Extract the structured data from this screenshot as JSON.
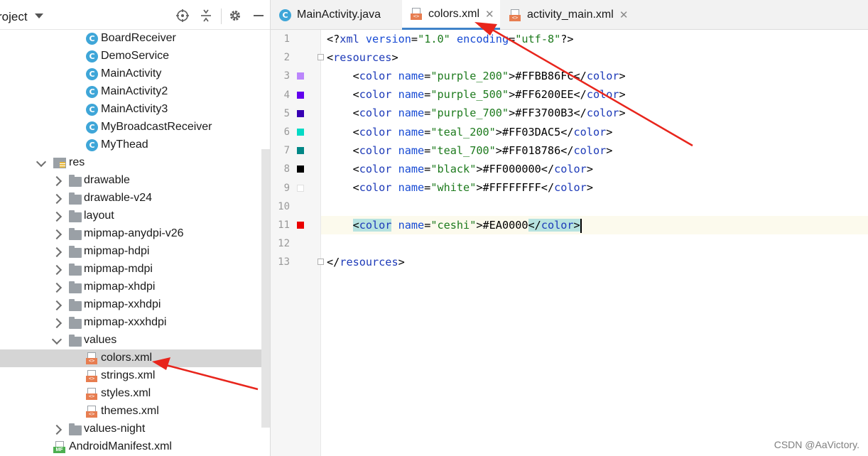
{
  "panel": {
    "title": "roject",
    "icons": [
      "target-icon",
      "collapse-all-icon",
      "gear-icon",
      "minimize-icon"
    ]
  },
  "tree": [
    {
      "label": "BoardReceiver",
      "kind": "class"
    },
    {
      "label": "DemoService",
      "kind": "class"
    },
    {
      "label": "MainActivity",
      "kind": "class"
    },
    {
      "label": "MainActivity2",
      "kind": "class"
    },
    {
      "label": "MainActivity3",
      "kind": "class"
    },
    {
      "label": "MyBroadcastReceiver",
      "kind": "class"
    },
    {
      "label": "MyThead",
      "kind": "class"
    },
    {
      "label": "res",
      "kind": "res",
      "expanded": true
    },
    {
      "label": "drawable",
      "kind": "folder"
    },
    {
      "label": "drawable-v24",
      "kind": "folder"
    },
    {
      "label": "layout",
      "kind": "folder"
    },
    {
      "label": "mipmap-anydpi-v26",
      "kind": "folder"
    },
    {
      "label": "mipmap-hdpi",
      "kind": "folder"
    },
    {
      "label": "mipmap-mdpi",
      "kind": "folder"
    },
    {
      "label": "mipmap-xhdpi",
      "kind": "folder"
    },
    {
      "label": "mipmap-xxhdpi",
      "kind": "folder"
    },
    {
      "label": "mipmap-xxxhdpi",
      "kind": "folder"
    },
    {
      "label": "values",
      "kind": "folder",
      "expanded": true
    },
    {
      "label": "colors.xml",
      "kind": "xml",
      "selected": true
    },
    {
      "label": "strings.xml",
      "kind": "xml"
    },
    {
      "label": "styles.xml",
      "kind": "xml"
    },
    {
      "label": "themes.xml",
      "kind": "xml"
    },
    {
      "label": "values-night",
      "kind": "folder"
    },
    {
      "label": "AndroidManifest.xml",
      "kind": "manifest"
    }
  ],
  "tabs": [
    {
      "label": "MainActivity.java",
      "icon": "java-class-icon",
      "active": false
    },
    {
      "label": "colors.xml",
      "icon": "xml-file-icon",
      "active": true
    },
    {
      "label": "activity_main.xml",
      "icon": "xml-file-icon",
      "active": false
    }
  ],
  "editor": {
    "lines": [
      {
        "n": "1",
        "swatch": null
      },
      {
        "n": "2",
        "swatch": null
      },
      {
        "n": "3",
        "swatch": "#BB86FC"
      },
      {
        "n": "4",
        "swatch": "#6200EE"
      },
      {
        "n": "5",
        "swatch": "#3700B3"
      },
      {
        "n": "6",
        "swatch": "#03DAC5"
      },
      {
        "n": "7",
        "swatch": "#018786"
      },
      {
        "n": "8",
        "swatch": "#000000"
      },
      {
        "n": "9",
        "swatch": "#FFFFFF"
      },
      {
        "n": "10",
        "swatch": null
      },
      {
        "n": "11",
        "swatch": "#EA0000"
      },
      {
        "n": "12",
        "swatch": null
      },
      {
        "n": "13",
        "swatch": null
      }
    ],
    "declaration": {
      "open": "<?",
      "name": "xml",
      "version_attr": "version",
      "version_val": "\"1.0\"",
      "enc_attr": "encoding",
      "enc_val": "\"utf-8\"",
      "close": "?>"
    },
    "resources_open": "resources",
    "resources_close": "resources",
    "colors": [
      {
        "name": "\"purple_200\"",
        "value": "#FFBB86FC"
      },
      {
        "name": "\"purple_500\"",
        "value": "#FF6200EE"
      },
      {
        "name": "\"purple_700\"",
        "value": "#FF3700B3"
      },
      {
        "name": "\"teal_200\"",
        "value": "#FF03DAC5"
      },
      {
        "name": "\"teal_700\"",
        "value": "#FF018786"
      },
      {
        "name": "\"black\"",
        "value": "#FF000000"
      },
      {
        "name": "\"white\"",
        "value": "#FFFFFFFF"
      }
    ],
    "new_color": {
      "name": "\"ceshi\"",
      "value": "#EA0000"
    },
    "tag_color": "color",
    "attr_name": "name"
  },
  "watermark": "CSDN @AaVictory.",
  "accent_colors": {
    "annotation_arrow": "#e8251c",
    "tab_underline": "#4083c9"
  }
}
